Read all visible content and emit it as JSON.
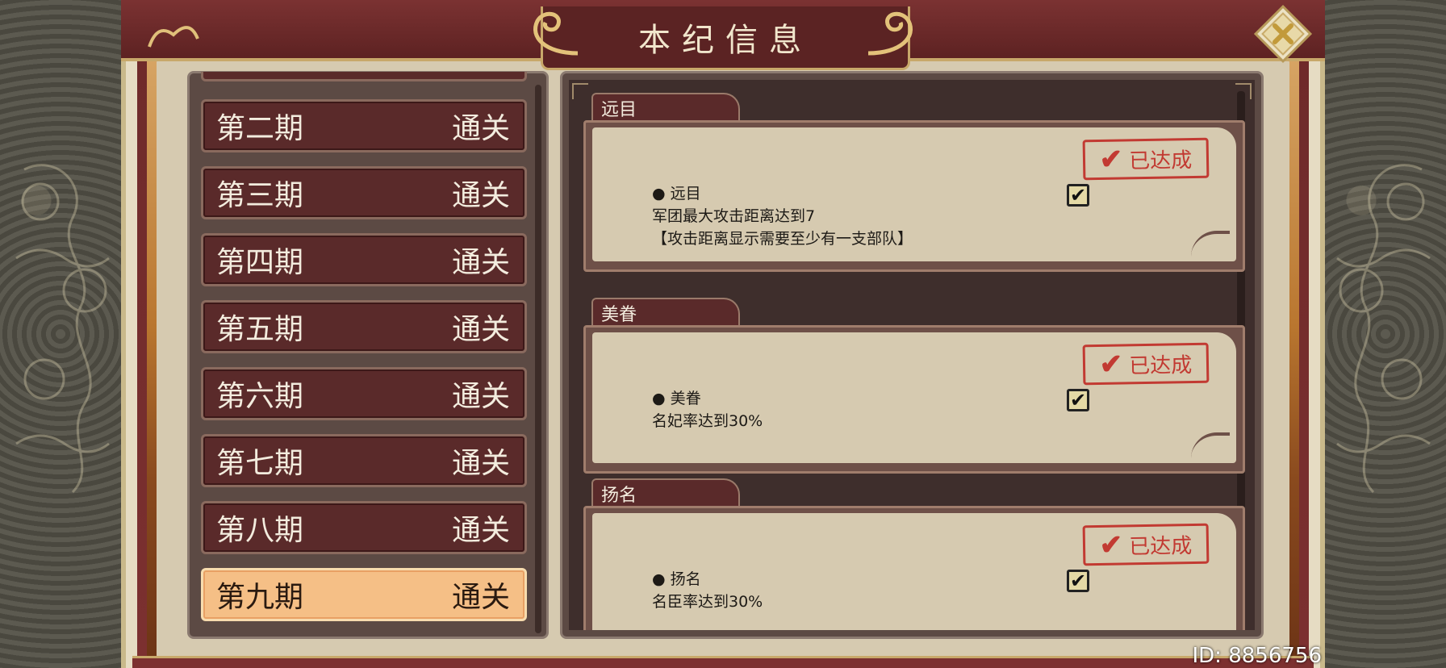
{
  "header": {
    "title": "本纪信息"
  },
  "period_list": {
    "items": [
      {
        "label": "第二期",
        "status": "通关",
        "active": false
      },
      {
        "label": "第三期",
        "status": "通关",
        "active": false
      },
      {
        "label": "第四期",
        "status": "通关",
        "active": false
      },
      {
        "label": "第五期",
        "status": "通关",
        "active": false
      },
      {
        "label": "第六期",
        "status": "通关",
        "active": false
      },
      {
        "label": "第七期",
        "status": "通关",
        "active": false
      },
      {
        "label": "第八期",
        "status": "通关",
        "active": false
      },
      {
        "label": "第九期",
        "status": "通关",
        "active": true
      }
    ]
  },
  "achievements": [
    {
      "tab": "远目",
      "stamp": "已达成",
      "bullet": "● 远目",
      "line1": "军团最大攻击距离达到7",
      "line2": "【攻击距离显示需要至少有一支部队】",
      "checked": true
    },
    {
      "tab": "美眷",
      "stamp": "已达成",
      "bullet": "● 美眷",
      "line1": "名妃率达到30%",
      "line2": "",
      "checked": true
    },
    {
      "tab": "扬名",
      "stamp": "已达成",
      "bullet": "● 扬名",
      "line1": "名臣率达到30%",
      "line2": "",
      "checked": true
    }
  ],
  "footer": {
    "id_text": "ID: 8856756"
  },
  "colors": {
    "accent_red": "#5a2a2a",
    "active_item": "#f5bf86",
    "stamp_red": "#c23a32",
    "paper": "#d6cab0"
  }
}
